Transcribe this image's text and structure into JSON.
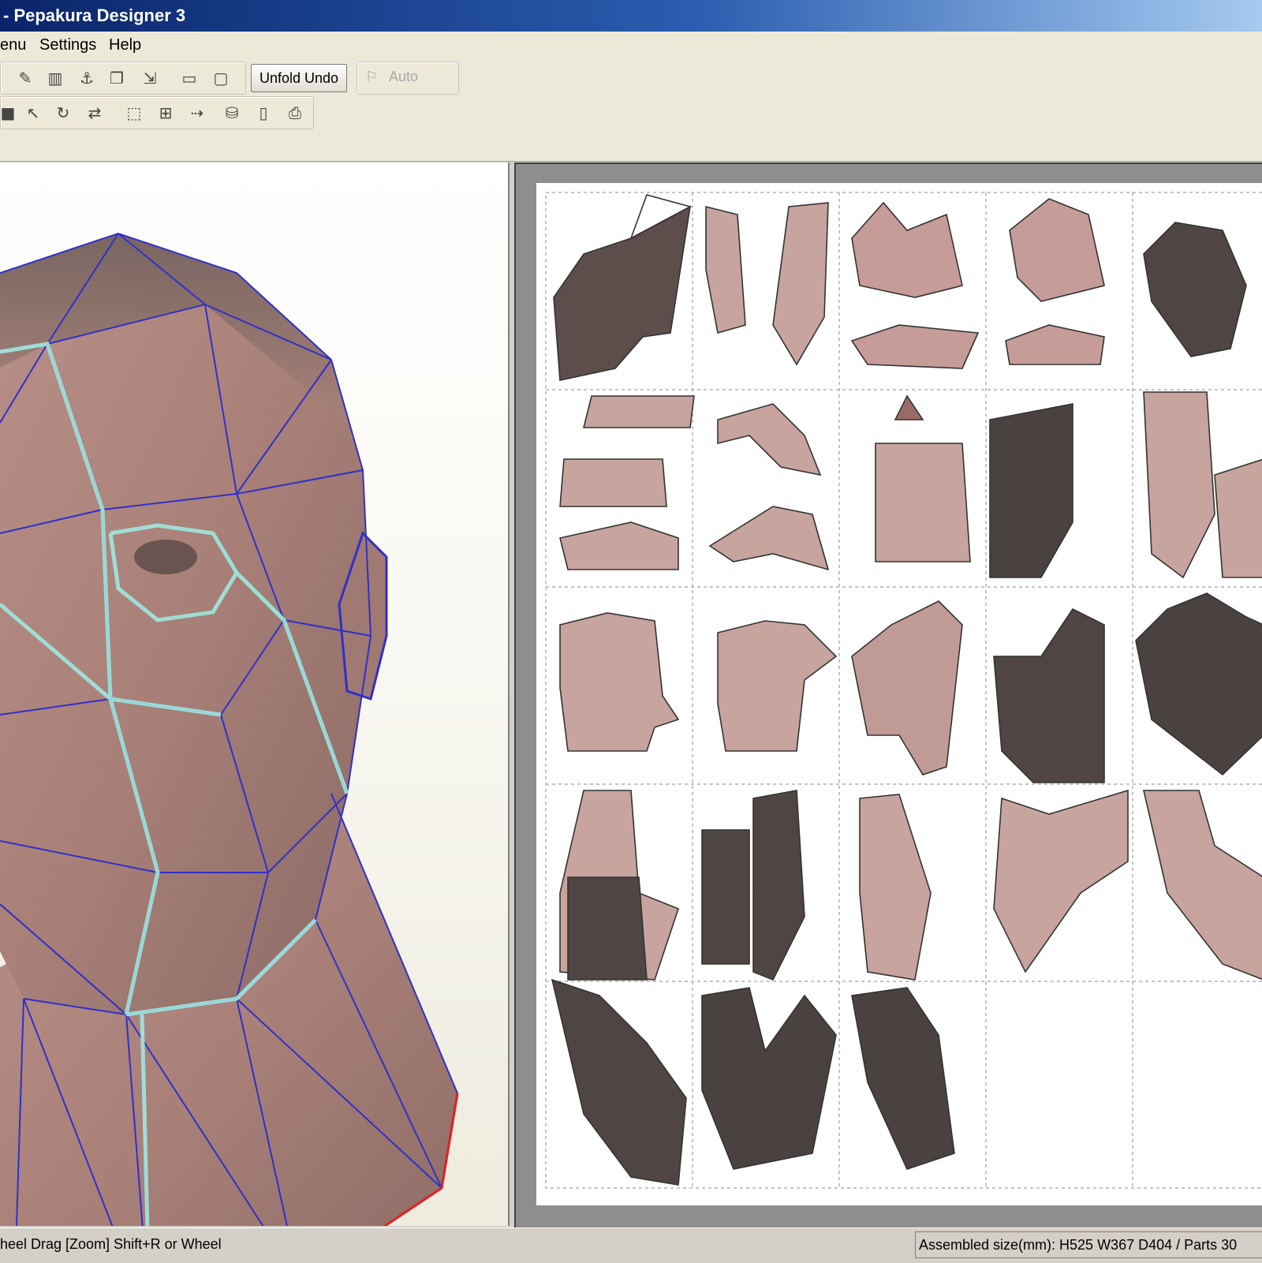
{
  "window": {
    "title": "- Pepakura Designer 3"
  },
  "menu": {
    "items": [
      "enu",
      "Settings",
      "Help"
    ]
  },
  "toolbar": {
    "unfold_undo_label": "Unfold Undo",
    "auto_label": "Auto",
    "row1_icons": [
      "pencil-icon",
      "texture-icon",
      "anchor-icon",
      "copy-icon",
      "join-icon",
      "window-icon",
      "window2-icon"
    ],
    "row2_icons": [
      "save-icon",
      "select-icon",
      "rotate-icon",
      "flip-icon",
      "arrange-icon",
      "grid-icon",
      "move-icon",
      "export-icon",
      "page-icon",
      "print-icon"
    ]
  },
  "statusbar": {
    "left_text": "heel Drag [Zoom] Shift+R or Wheel",
    "right_text": "Assembled size(mm): H525 W367 D404 / Parts 30"
  },
  "colors": {
    "title_start": "#0a246a",
    "title_end": "#a6caf0",
    "mesh_edge": "#3030c8",
    "cut_edge": "#e02020",
    "fold_highlight": "#9ee8e0",
    "part_light": "#c9a8a2",
    "part_dark": "#4a4040"
  }
}
